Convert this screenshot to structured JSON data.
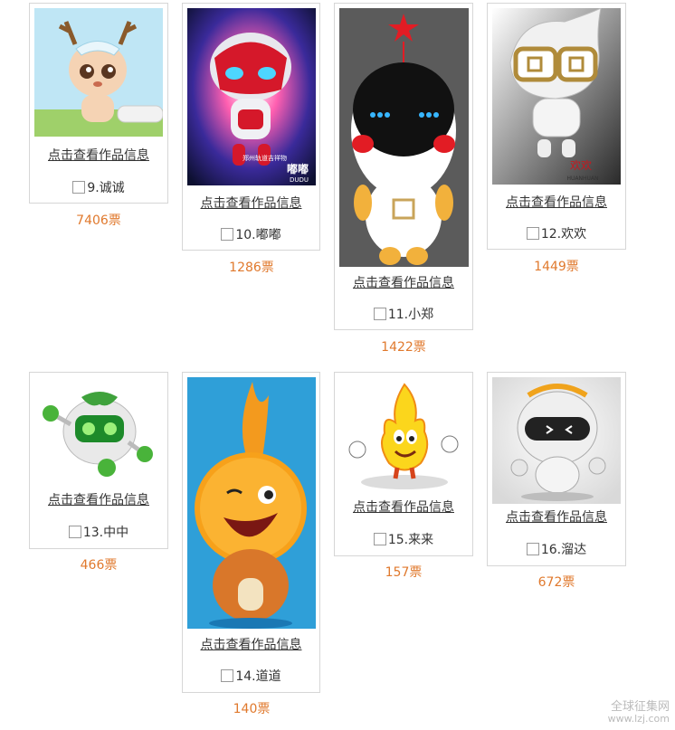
{
  "link_label": "点击查看作品信息",
  "items": [
    {
      "num": "9.诚诚",
      "votes": "7406票",
      "image": "deer-mascot-with-train"
    },
    {
      "num": "10.嘟嘟",
      "votes": "1286票",
      "image": "red-robot-mascot"
    },
    {
      "num": "11.小郑",
      "votes": "1422票",
      "image": "black-head-mascot-with-star"
    },
    {
      "num": "12.欢欢",
      "votes": "1449票",
      "image": "white-mascot-gold-glasses"
    },
    {
      "num": "13.中中",
      "votes": "466票",
      "image": "green-white-robot-mascot"
    },
    {
      "num": "14.道道",
      "votes": "140票",
      "image": "orange-flame-mascot"
    },
    {
      "num": "15.来来",
      "votes": "157票",
      "image": "yellow-flame-mascot"
    },
    {
      "num": "16.溜达",
      "votes": "672票",
      "image": "silver-robot-mascot"
    }
  ],
  "thumb_texts": {
    "dudu_caption": "郑州轨道吉祥物",
    "dudu_name": "嘟嘟",
    "dudu_en": "DUDU",
    "huanhuan_caption": "欢欢",
    "huanhuan_pinyin": "HUANHUAN"
  },
  "watermark": {
    "line1": "全球征集网",
    "line2": "www.lzj.com"
  },
  "colors": {
    "votes": "#e0792d",
    "border": "#d6d6d6"
  }
}
